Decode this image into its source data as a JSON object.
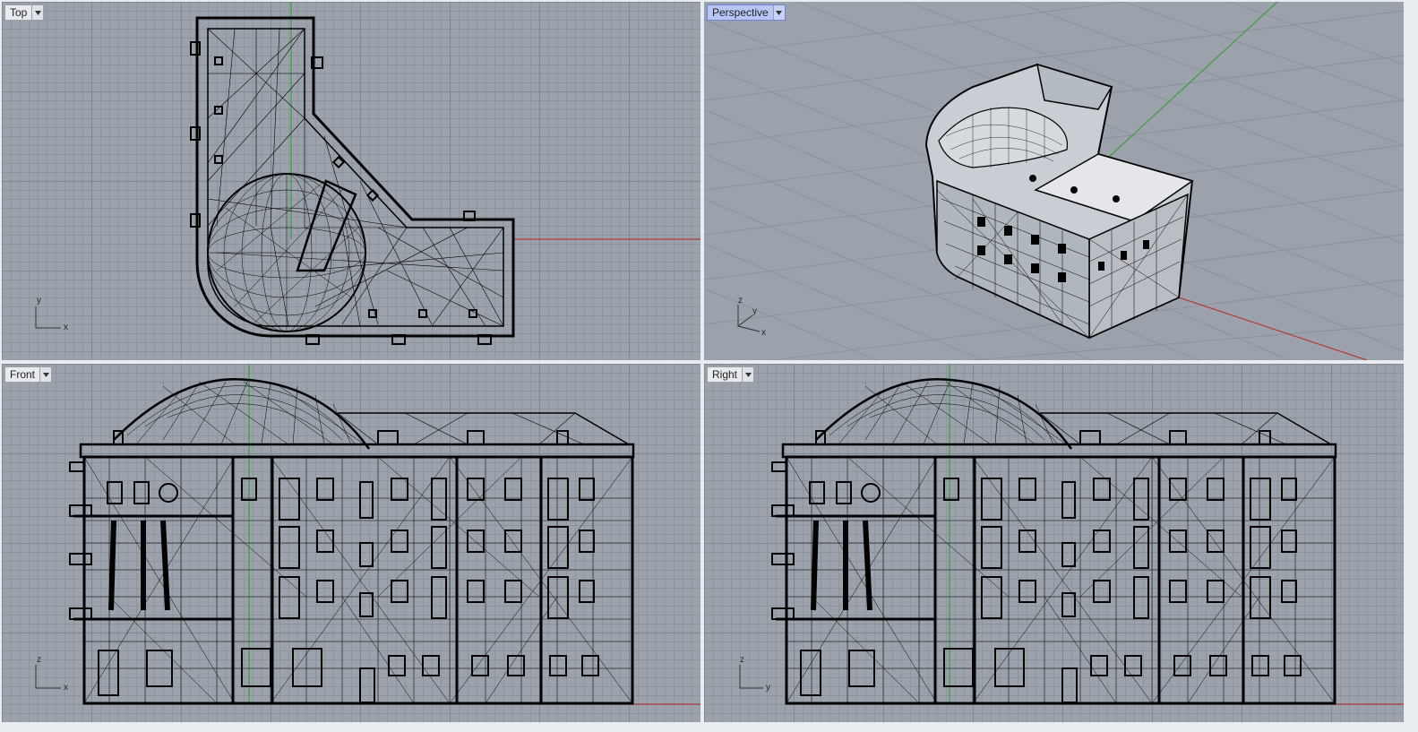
{
  "viewports": {
    "top": {
      "label": "Top",
      "axis_a": "y",
      "axis_b": "x"
    },
    "perspective": {
      "label": "Perspective",
      "axis_a": "z",
      "axis_b": "y",
      "axis_c": "x"
    },
    "front": {
      "label": "Front",
      "axis_a": "z",
      "axis_b": "x"
    },
    "right": {
      "label": "Right",
      "axis_a": "z",
      "axis_b": "y"
    }
  },
  "colors": {
    "viewport_bg": "#9ba2ab",
    "x_axis": "#b03a3a",
    "y_axis": "#3aa03a",
    "active_tab": "#b7c6f5",
    "wireframe": "#000000"
  },
  "icons": {
    "dropdown": "chevron-down-icon"
  }
}
